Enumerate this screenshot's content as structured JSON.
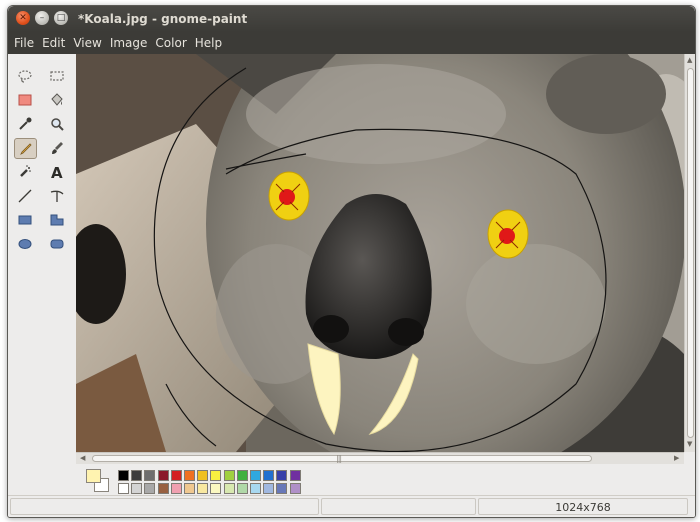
{
  "window": {
    "title": "*Koala.jpg - gnome-paint",
    "buttons": {
      "close": "close-icon",
      "minimize": "minimize-icon",
      "maximize": "maximize-icon"
    }
  },
  "menubar": {
    "items": [
      "File",
      "Edit",
      "View",
      "Image",
      "Color",
      "Help"
    ]
  },
  "toolbox": {
    "tools": [
      "lasso-select-icon",
      "rect-select-icon",
      "eraser-icon",
      "fill-bucket-icon",
      "color-picker-icon",
      "zoom-icon",
      "pencil-icon",
      "paintbrush-icon",
      "airbrush-icon",
      "text-icon",
      "line-icon",
      "curve-icon",
      "rectangle-icon",
      "polygon-icon",
      "ellipse-icon",
      "rounded-rect-icon"
    ],
    "active_tool": "pencil-icon"
  },
  "colors": {
    "foreground": "#fff3b0",
    "background": "#ffffff",
    "palette_row1": [
      "#000000",
      "#3c3c3c",
      "#6e6e6e",
      "#8a1a2a",
      "#d42020",
      "#f07020",
      "#f0c020",
      "#f8f040",
      "#a0d040",
      "#40b040",
      "#30a8e0",
      "#2070d0",
      "#3840a8",
      "#7030a0"
    ],
    "palette_row2": [
      "#ffffff",
      "#d4d4d4",
      "#a8a8a8",
      "#986040",
      "#f0a0b0",
      "#f0c890",
      "#f8e8a0",
      "#fbf8c0",
      "#d8e8b0",
      "#b0d8a8",
      "#a8d8f0",
      "#a0b8e0",
      "#6878b8",
      "#b090c8"
    ]
  },
  "statusbar": {
    "cells": [
      "",
      "",
      "1024x768"
    ]
  }
}
